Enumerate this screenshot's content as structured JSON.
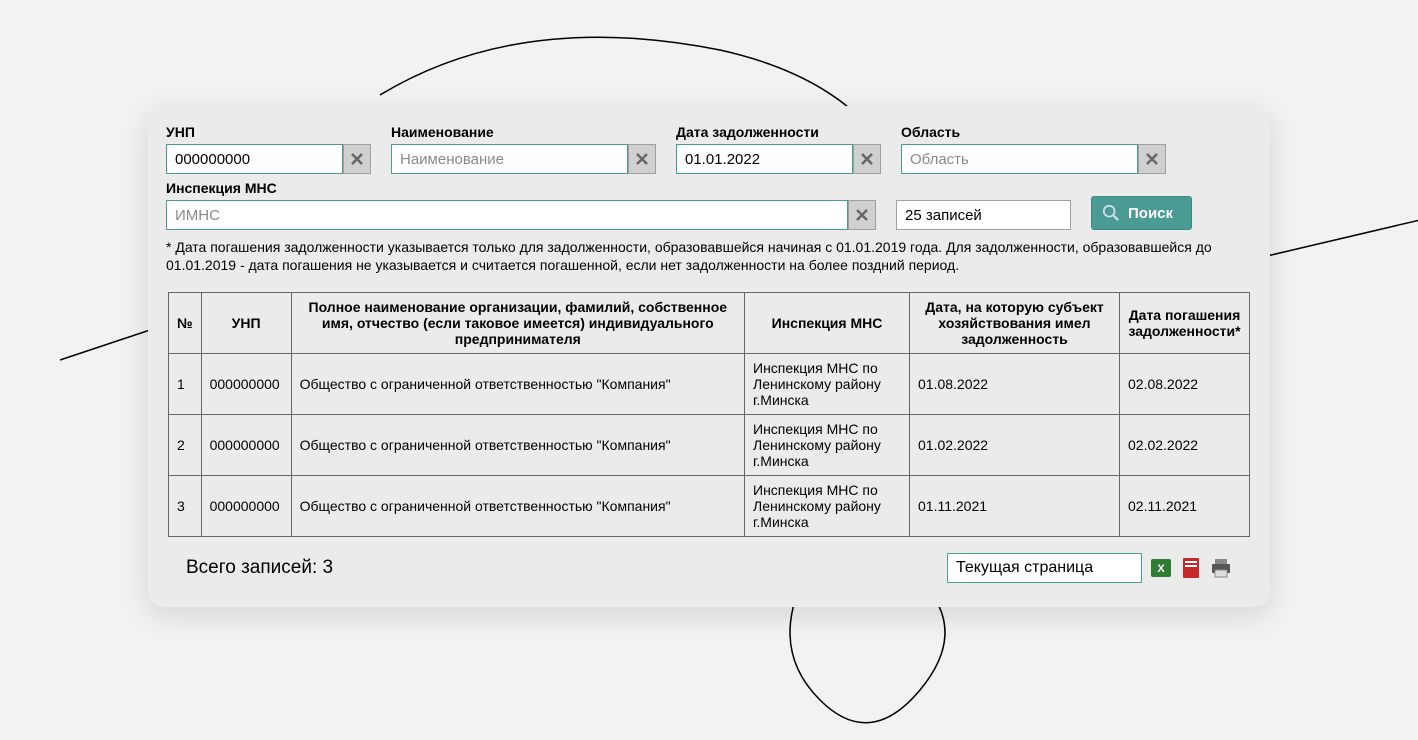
{
  "filters": {
    "unp": {
      "label": "УНП",
      "value": "000000000"
    },
    "name": {
      "label": "Наименование",
      "placeholder": "Наименование",
      "value": ""
    },
    "date": {
      "label": "Дата задолженности",
      "value": "01.01.2022"
    },
    "region": {
      "label": "Область",
      "placeholder": "Область",
      "value": ""
    },
    "imns": {
      "label": "Инспекция МНС",
      "placeholder": "ИМНС",
      "value": ""
    }
  },
  "records": {
    "value": "25 записей"
  },
  "search": {
    "label": "Поиск"
  },
  "note": "* Дата погашения задолженности указывается только для задолженности, образовавшейся начиная с 01.01.2019 года. Для задолженности, образовавшейся до 01.01.2019 - дата погашения не указывается и считается погашенной, если нет задолженности на более поздний период.",
  "table": {
    "headers": {
      "n": "№",
      "unp": "УНП",
      "full": "Полное наименование организации, фамилий, собственное имя, отчество (если таковое имеется) индивидуального предпринимателя",
      "insp": "Инспекция МНС",
      "date1": "Дата, на которую субъект хозяйствования имел задолженность",
      "date2": "Дата погашения задолженности*"
    },
    "rows": [
      {
        "n": "1",
        "unp": "000000000",
        "full": "Общество с ограниченной ответственностью \"Компания\"",
        "insp": "Инспекция МНС по Ленинскому району г.Минска",
        "date1": "01.08.2022",
        "date2": "02.08.2022"
      },
      {
        "n": "2",
        "unp": "000000000",
        "full": "Общество с ограниченной ответственностью \"Компания\"",
        "insp": "Инспекция МНС по Ленинскому району г.Минска",
        "date1": "01.02.2022",
        "date2": "02.02.2022"
      },
      {
        "n": "3",
        "unp": "000000000",
        "full": "Общество с ограниченной ответственностью \"Компания\"",
        "insp": "Инспекция МНС по Ленинскому району г.Минска",
        "date1": "01.11.2021",
        "date2": "02.11.2021"
      }
    ]
  },
  "footer": {
    "total": "Всего записей: 3",
    "page_select": "Текущая страница"
  }
}
